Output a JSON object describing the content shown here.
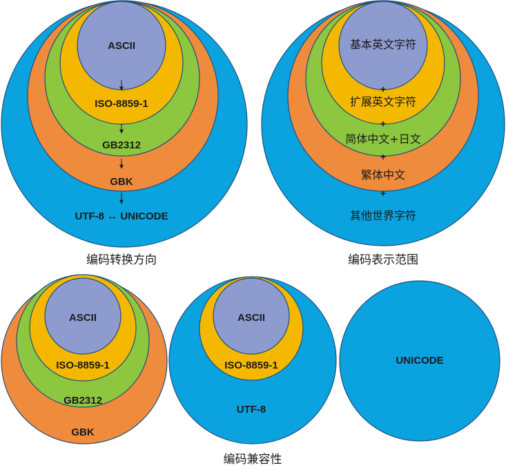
{
  "colors": {
    "blue": "#0aa3e0",
    "orange": "#ef8b3c",
    "green": "#8dc63f",
    "yellow": "#f5b800",
    "lavender": "#8e9bcf"
  },
  "direction": {
    "caption": "编码转换方向",
    "labels": [
      "ASCII",
      "ISO-8859-1",
      "GB2312",
      "GBK",
      "UTF-8 ↔ UNICODE"
    ]
  },
  "range": {
    "caption": "编码表示范围",
    "labels": [
      "基本英文字符",
      "扩展英文字符",
      "简体中文+日文",
      "繁体中文",
      "其他世界字符"
    ],
    "plus": "+"
  },
  "compat": {
    "caption": "编码兼容性",
    "gbk_labels": [
      "ASCII",
      "ISO-8859-1",
      "GB2312",
      "GBK"
    ],
    "utf8_labels": [
      "ASCII",
      "ISO-8859-1",
      "UTF-8"
    ],
    "unicode_label": "UNICODE"
  }
}
